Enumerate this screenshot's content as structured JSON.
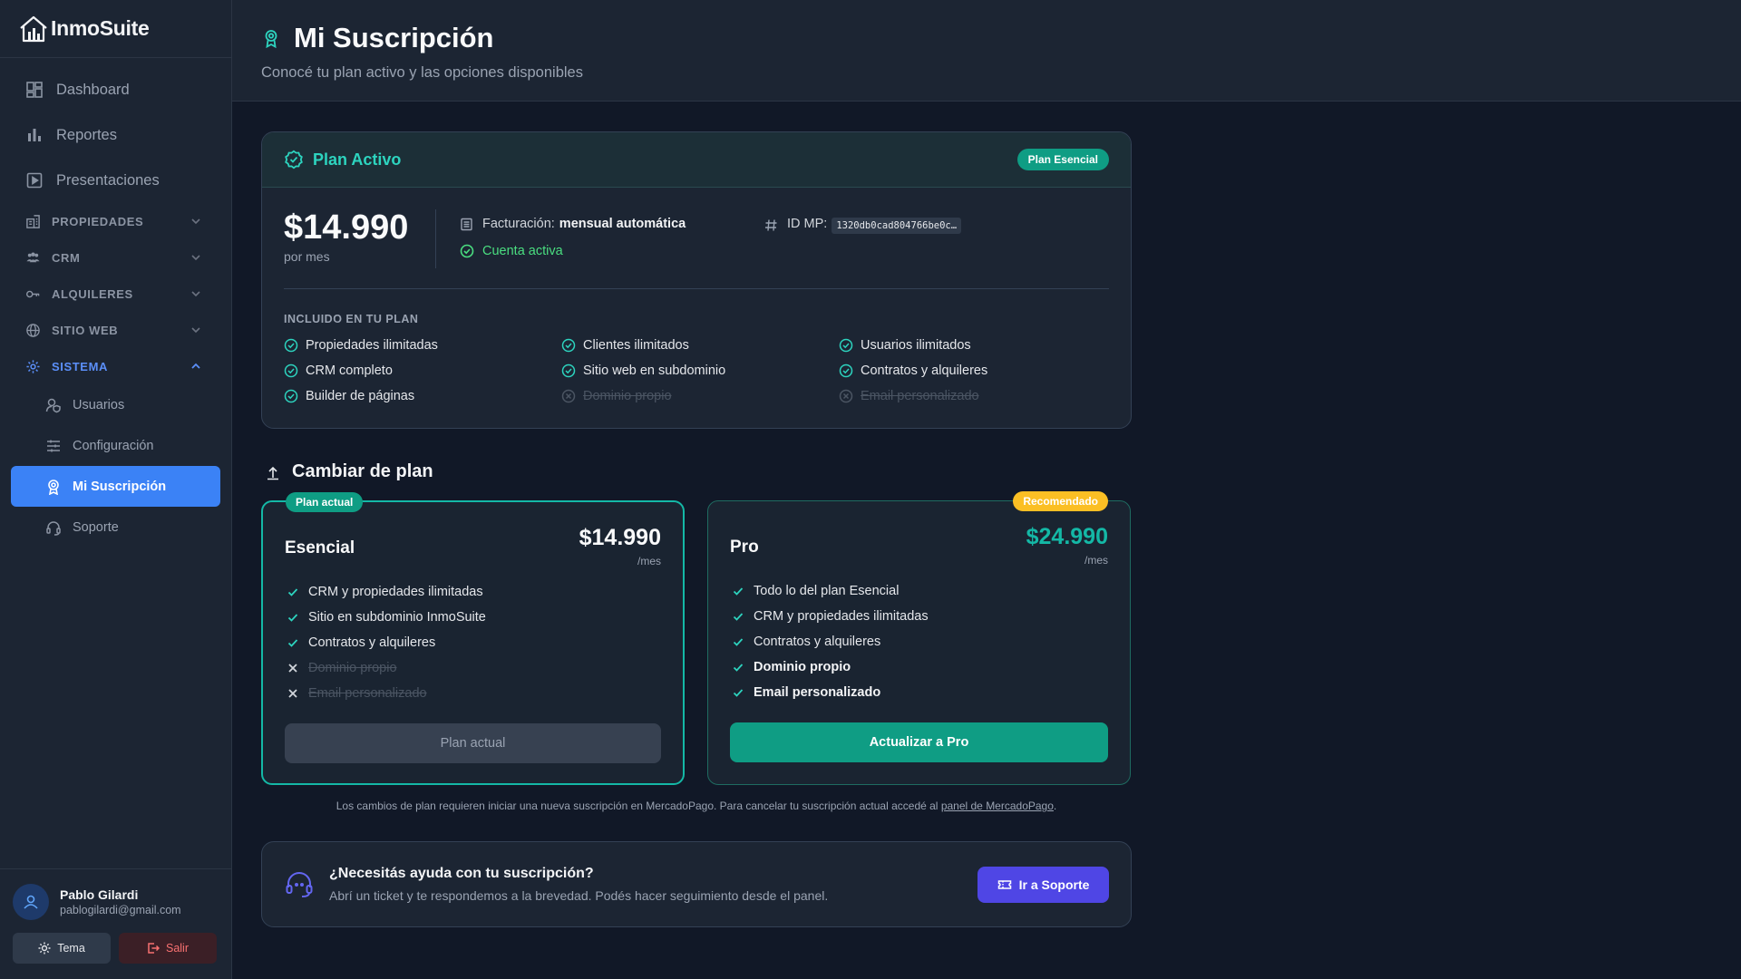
{
  "app": {
    "name": "InmoSuite"
  },
  "sidebar": {
    "nav": [
      {
        "label": "Dashboard",
        "icon": "grid-icon"
      },
      {
        "label": "Reportes",
        "icon": "bar-chart-icon"
      },
      {
        "label": "Presentaciones",
        "icon": "play-square-icon"
      }
    ],
    "sections": [
      {
        "label": "PROPIEDADES",
        "icon": "building-icon"
      },
      {
        "label": "CRM",
        "icon": "users-icon"
      },
      {
        "label": "ALQUILERES",
        "icon": "key-icon"
      },
      {
        "label": "SITIO WEB",
        "icon": "globe-icon"
      },
      {
        "label": "SISTEMA",
        "icon": "gear-icon"
      }
    ],
    "system_items": [
      {
        "label": "Usuarios",
        "icon": "user-shield-icon"
      },
      {
        "label": "Configuración",
        "icon": "sliders-icon"
      },
      {
        "label": "Mi Suscripción",
        "icon": "award-icon"
      },
      {
        "label": "Soporte",
        "icon": "headset-icon"
      }
    ],
    "user": {
      "name": "Pablo Gilardi",
      "email": "pablogilardi@gmail.com"
    },
    "theme_label": "Tema",
    "logout_label": "Salir"
  },
  "header": {
    "title": "Mi Suscripción",
    "subtitle": "Conocé tu plan activo y las opciones disponibles"
  },
  "active_plan": {
    "title": "Plan Activo",
    "badge": "Plan Esencial",
    "price": "$14.990",
    "period": "por mes",
    "billing_label": "Facturación:",
    "billing_value": "mensual automática",
    "status": "Cuenta activa",
    "id_label": "ID MP:",
    "id_value": "1320db0cad804766be0c…",
    "included_title": "INCLUIDO EN TU PLAN",
    "features": [
      {
        "label": "Propiedades ilimitadas",
        "enabled": true
      },
      {
        "label": "Clientes ilimitados",
        "enabled": true
      },
      {
        "label": "Usuarios ilimitados",
        "enabled": true
      },
      {
        "label": "CRM completo",
        "enabled": true
      },
      {
        "label": "Sitio web en subdominio",
        "enabled": true
      },
      {
        "label": "Contratos y alquileres",
        "enabled": true
      },
      {
        "label": "Builder de páginas",
        "enabled": true
      },
      {
        "label": "Dominio propio",
        "enabled": false
      },
      {
        "label": "Email personalizado",
        "enabled": false
      }
    ]
  },
  "change_plan": {
    "title": "Cambiar de plan",
    "plans": [
      {
        "tag": "Plan actual",
        "name": "Esencial",
        "price": "$14.990",
        "period": "/mes",
        "features": [
          {
            "label": "CRM y propiedades ilimitadas",
            "enabled": true
          },
          {
            "label": "Sitio en subdominio InmoSuite",
            "enabled": true
          },
          {
            "label": "Contratos y alquileres",
            "enabled": true
          },
          {
            "label": "Dominio propio",
            "enabled": false
          },
          {
            "label": "Email personalizado",
            "enabled": false
          }
        ],
        "button": "Plan actual"
      },
      {
        "tag": "Recomendado",
        "name": "Pro",
        "price": "$24.990",
        "period": "/mes",
        "features": [
          {
            "label": "Todo lo del plan Esencial",
            "enabled": true
          },
          {
            "label": "CRM y propiedades ilimitadas",
            "enabled": true
          },
          {
            "label": "Contratos y alquileres",
            "enabled": true
          },
          {
            "label": "Dominio propio",
            "enabled": true,
            "bold": true
          },
          {
            "label": "Email personalizado",
            "enabled": true,
            "bold": true
          }
        ],
        "button": "Actualizar a Pro"
      }
    ],
    "note_text": "Los cambios de plan requieren iniciar una nueva suscripción en MercadoPago. Para cancelar tu suscripción actual accedé al",
    "note_link": "panel de MercadoPago",
    "note_end": "."
  },
  "help": {
    "title": "¿Necesitás ayuda con tu suscripción?",
    "description": "Abrí un ticket y te respondemos a la brevedad. Podés hacer seguimiento desde el panel.",
    "button": "Ir a Soporte"
  },
  "colors": {
    "accent": "#3b82f6",
    "teal": "#14b8a6",
    "badge_teal": "#0f9d84",
    "recommended": "#fbbf24",
    "support": "#4f46e5"
  }
}
